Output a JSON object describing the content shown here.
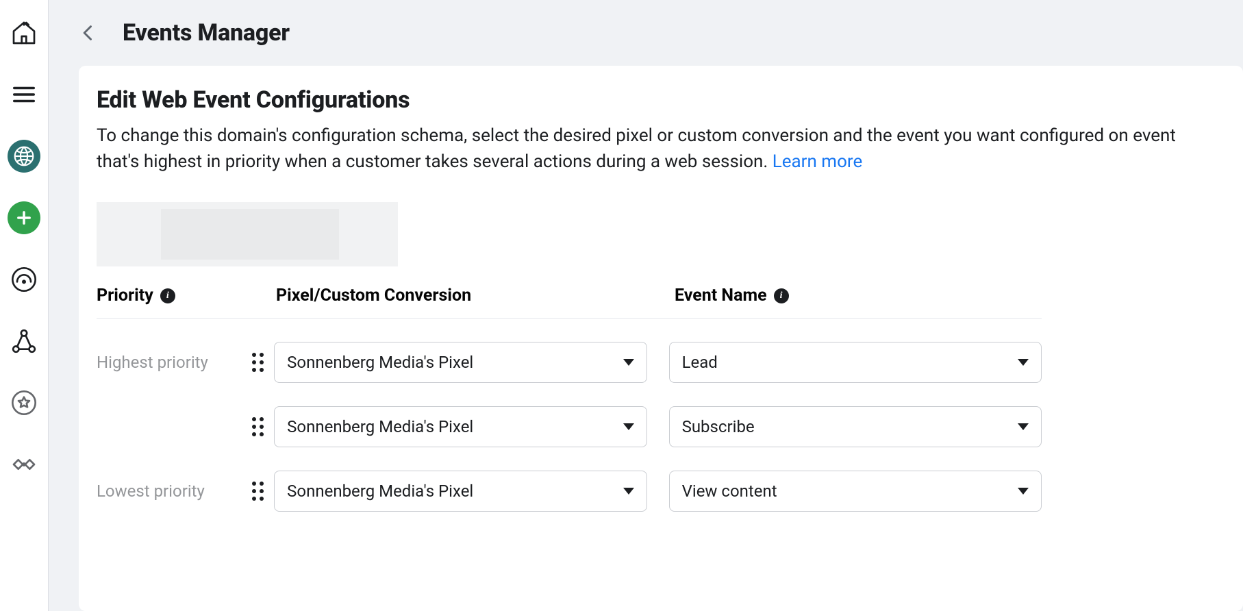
{
  "header": {
    "title": "Events Manager"
  },
  "panel": {
    "title": "Edit Web Event Configurations",
    "description": "To change this domain's configuration schema, select the desired pixel or custom conversion and the event you want configured on event that's highest in priority when a customer takes several actions during a web session. ",
    "learn_more": "Learn more"
  },
  "table": {
    "columns": {
      "priority": "Priority",
      "pixel": "Pixel/Custom Conversion",
      "event": "Event Name"
    },
    "rows": [
      {
        "priority_label": "Highest priority",
        "pixel": "Sonnenberg Media's Pixel",
        "event": "Lead"
      },
      {
        "priority_label": "",
        "pixel": "Sonnenberg Media's Pixel",
        "event": "Subscribe"
      },
      {
        "priority_label": "Lowest priority",
        "pixel": "Sonnenberg Media's Pixel",
        "event": "View content"
      }
    ]
  },
  "sidebar_icons": [
    "home",
    "menu",
    "data-sources",
    "add",
    "audience",
    "custom-conversions",
    "favorites",
    "partner-integrations"
  ]
}
